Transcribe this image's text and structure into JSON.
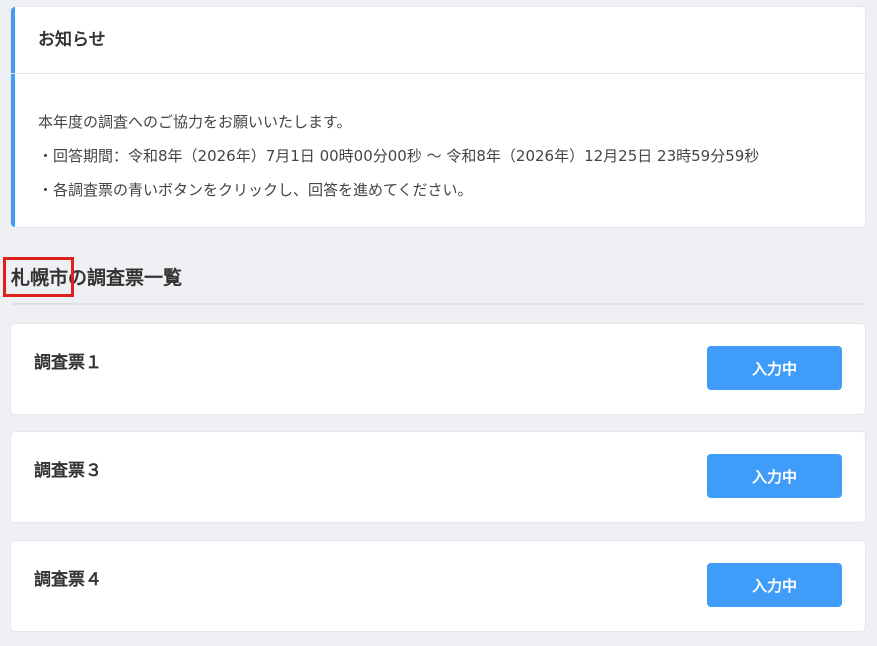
{
  "notice": {
    "title": "お知らせ",
    "lines": [
      "本年度の調査へのご協力をお願いいたします。",
      "・回答期間：令和8年（2026年）7月1日 00時00分00秒 ～ 令和8年（2026年）12月25日 23時59分59秒",
      "・各調査票の青いボタンをクリックし、回答を進めてください。"
    ]
  },
  "survey_list": {
    "city": "札幌市",
    "heading_suffix": "の調査票一覧",
    "items": [
      {
        "name": "調査票１",
        "button_label": "入力中"
      },
      {
        "name": "調査票３",
        "button_label": "入力中"
      },
      {
        "name": "調査票４",
        "button_label": "入力中"
      }
    ]
  },
  "colors": {
    "accent": "#3f9cf8",
    "highlight": "#e0201c",
    "background": "#eef0f3"
  }
}
